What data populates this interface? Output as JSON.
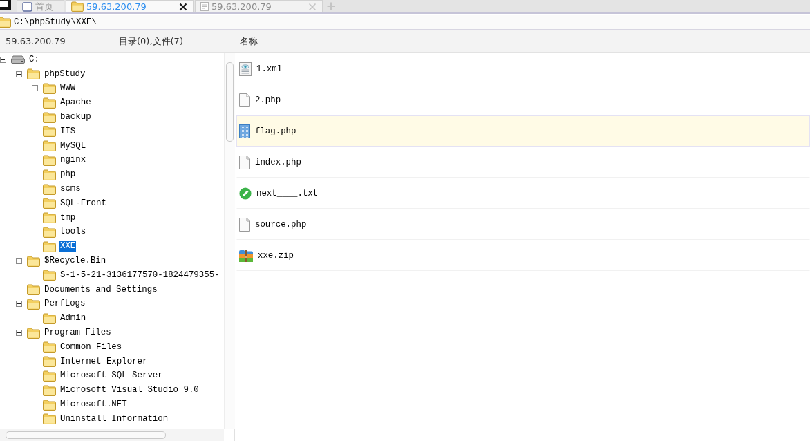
{
  "tabs": [
    {
      "label": "首页",
      "kind": "home",
      "selected": false,
      "closable": false
    },
    {
      "label": "59.63.200.79",
      "kind": "folder",
      "selected": true,
      "closable": true
    },
    {
      "label": "59.63.200.79",
      "kind": "document",
      "selected": false,
      "closable": true
    }
  ],
  "address_bar": {
    "path": "C:\\phpStudy\\XXE\\"
  },
  "header": {
    "server": "59.63.200.79",
    "summary": "目录(0),文件(7)",
    "name_column": "名称"
  },
  "tree": [
    {
      "label": "C:",
      "kind": "drive",
      "expanded": true,
      "selected": false,
      "children": [
        {
          "label": "phpStudy",
          "kind": "folder",
          "expanded": true,
          "selected": false,
          "children": [
            {
              "label": "WWW",
              "kind": "folder",
              "expanded": false,
              "selected": false
            },
            {
              "label": "Apache",
              "kind": "folder",
              "selected": false
            },
            {
              "label": "backup",
              "kind": "folder",
              "selected": false
            },
            {
              "label": "IIS",
              "kind": "folder",
              "selected": false
            },
            {
              "label": "MySQL",
              "kind": "folder",
              "selected": false
            },
            {
              "label": "nginx",
              "kind": "folder",
              "selected": false
            },
            {
              "label": "php",
              "kind": "folder",
              "selected": false
            },
            {
              "label": "scms",
              "kind": "folder",
              "selected": false
            },
            {
              "label": "SQL-Front",
              "kind": "folder",
              "selected": false
            },
            {
              "label": "tmp",
              "kind": "folder",
              "selected": false
            },
            {
              "label": "tools",
              "kind": "folder",
              "selected": false
            },
            {
              "label": "XXE",
              "kind": "folder",
              "selected": true
            }
          ]
        },
        {
          "label": "$Recycle.Bin",
          "kind": "folder",
          "expanded": true,
          "selected": false,
          "children": [
            {
              "label": "S-1-5-21-3136177570-1824479355-",
              "kind": "folder",
              "selected": false
            }
          ]
        },
        {
          "label": "Documents and Settings",
          "kind": "folder",
          "selected": false
        },
        {
          "label": "PerfLogs",
          "kind": "folder",
          "expanded": true,
          "selected": false,
          "children": [
            {
              "label": "Admin",
              "kind": "folder",
              "selected": false
            }
          ]
        },
        {
          "label": "Program Files",
          "kind": "folder",
          "expanded": true,
          "selected": false,
          "children": [
            {
              "label": "Common Files",
              "kind": "folder",
              "selected": false
            },
            {
              "label": "Internet Explorer",
              "kind": "folder",
              "selected": false
            },
            {
              "label": "Microsoft SQL Server",
              "kind": "folder",
              "selected": false
            },
            {
              "label": "Microsoft Visual Studio 9.0",
              "kind": "folder",
              "selected": false
            },
            {
              "label": "Microsoft.NET",
              "kind": "folder",
              "selected": false
            },
            {
              "label": "Uninstall Information",
              "kind": "folder",
              "selected": false
            }
          ]
        }
      ]
    }
  ],
  "files": [
    {
      "name": "1.xml",
      "kind": "xml",
      "selected": false
    },
    {
      "name": "2.php",
      "kind": "document",
      "selected": false
    },
    {
      "name": "flag.php",
      "kind": "patterned",
      "selected": true
    },
    {
      "name": "index.php",
      "kind": "document",
      "selected": false
    },
    {
      "name": "next____.txt",
      "kind": "note",
      "selected": false
    },
    {
      "name": "source.php",
      "kind": "document",
      "selected": false
    },
    {
      "name": "xxe.zip",
      "kind": "archive",
      "selected": false
    }
  ]
}
